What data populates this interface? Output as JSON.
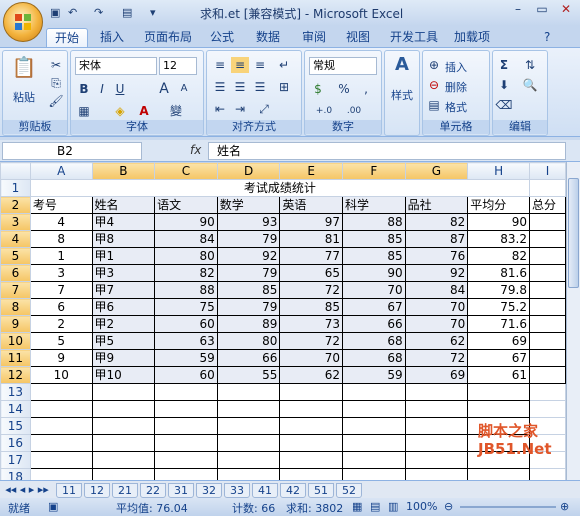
{
  "window": {
    "title": "求和.et  [兼容模式] - Microsoft Excel",
    "min_label": "–",
    "max_label": "▭",
    "close_label": "✕"
  },
  "tabs": [
    "开始",
    "插入",
    "页面布局",
    "公式",
    "数据",
    "审阅",
    "视图",
    "开发工具",
    "加载项"
  ],
  "ribbon": {
    "clipboard": {
      "label": "剪贴板",
      "paste": "粘贴"
    },
    "font": {
      "label": "字体",
      "name": "宋体",
      "size": "12",
      "bold": "B",
      "italic": "I",
      "underline": "U",
      "grow": "A",
      "shrink": "A",
      "wen": "變"
    },
    "align": {
      "label": "对齐方式"
    },
    "number": {
      "label": "数字",
      "format": "常规",
      "percent": "%",
      "comma": ",",
      "dec_inc": "+.0",
      "dec_dec": ".00"
    },
    "style": {
      "label": "样式"
    },
    "cells": {
      "label": "单元格",
      "insert": "插入",
      "delete": "删除",
      "format": "格式"
    },
    "edit": {
      "label": "编辑",
      "sum": "Σ"
    }
  },
  "formula_bar": {
    "name_box": "B2",
    "fx": "fx",
    "formula": "姓名"
  },
  "grid": {
    "columns": [
      "A",
      "B",
      "C",
      "D",
      "E",
      "F",
      "G",
      "H",
      "I"
    ],
    "rows": [
      "1",
      "2",
      "3",
      "4",
      "5",
      "6",
      "7",
      "8",
      "9",
      "10",
      "11",
      "12",
      "13",
      "14",
      "15",
      "16",
      "17",
      "18"
    ],
    "title": "考试成绩统计",
    "header": [
      "考号",
      "姓名",
      "语文",
      "数学",
      "英语",
      "科学",
      "品社",
      "平均分",
      "总分"
    ],
    "data": [
      [
        "4",
        "甲4",
        "90",
        "93",
        "97",
        "88",
        "82",
        "90"
      ],
      [
        "8",
        "甲8",
        "84",
        "79",
        "81",
        "85",
        "87",
        "83.2"
      ],
      [
        "1",
        "甲1",
        "80",
        "92",
        "77",
        "85",
        "76",
        "82"
      ],
      [
        "3",
        "甲3",
        "82",
        "79",
        "65",
        "90",
        "92",
        "81.6"
      ],
      [
        "7",
        "甲7",
        "88",
        "85",
        "72",
        "70",
        "84",
        "79.8"
      ],
      [
        "6",
        "甲6",
        "75",
        "79",
        "85",
        "67",
        "70",
        "75.2"
      ],
      [
        "2",
        "甲2",
        "60",
        "89",
        "73",
        "66",
        "70",
        "71.6"
      ],
      [
        "5",
        "甲5",
        "63",
        "80",
        "72",
        "68",
        "62",
        "69"
      ],
      [
        "9",
        "甲9",
        "59",
        "66",
        "70",
        "68",
        "72",
        "67"
      ],
      [
        "10",
        "甲10",
        "60",
        "55",
        "62",
        "59",
        "69",
        "61"
      ]
    ]
  },
  "sheet_tabs": [
    "11",
    "12",
    "21",
    "22",
    "31",
    "32",
    "33",
    "41",
    "42",
    "51",
    "52"
  ],
  "status": {
    "mode": "就绪",
    "average": "平均值: 76.04",
    "count": "计数: 66",
    "sum": "求和: 3802",
    "zoom": "100%"
  },
  "watermark": {
    "line1": "脚本之家",
    "line2": "JB51.Net"
  }
}
